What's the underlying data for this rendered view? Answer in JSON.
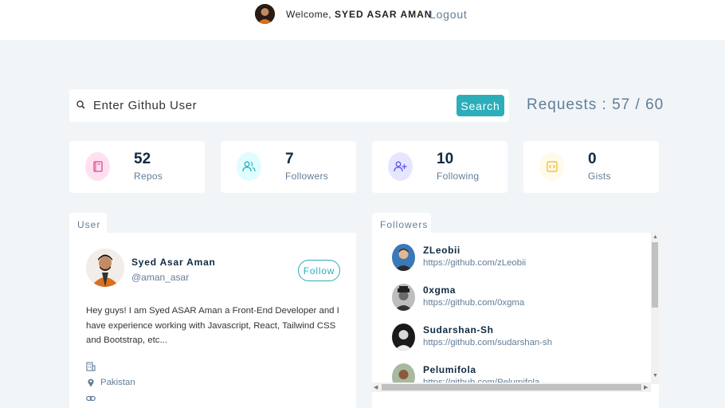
{
  "nav": {
    "welcome_prefix": "Welcome,",
    "username": "SYED ASAR AMAN",
    "logout": "Logout"
  },
  "search": {
    "placeholder": "Enter Github User",
    "button": "Search",
    "requests": "Requests : 57 / 60"
  },
  "stats": [
    {
      "value": "52",
      "label": "Repos",
      "icon": "book-icon",
      "color": "#da4a91",
      "bg": "#ffe0f0"
    },
    {
      "value": "7",
      "label": "Followers",
      "icon": "users-icon",
      "color": "#2caeba",
      "bg": "#e0fcff"
    },
    {
      "value": "10",
      "label": "Following",
      "icon": "user-plus-icon",
      "color": "#5d55fa",
      "bg": "#e6e6ff"
    },
    {
      "value": "0",
      "label": "Gists",
      "icon": "code-icon",
      "color": "#f0b429",
      "bg": "#fffbea"
    }
  ],
  "user": {
    "tab": "User",
    "name": "Syed Asar Aman",
    "handle": "@aman_asar",
    "follow": "Follow",
    "bio": "Hey guys! I am Syed ASAR Aman a Front-End Developer and I have experience working with Javascript, React, Tailwind CSS and Bootstrap, etc...",
    "location": "Pakistan"
  },
  "followers": {
    "tab": "Followers",
    "items": [
      {
        "name": "ZLeobii",
        "url": "https://github.com/zLeobii"
      },
      {
        "name": "0xgma",
        "url": "https://github.com/0xgma"
      },
      {
        "name": "Sudarshan-Sh",
        "url": "https://github.com/sudarshan-sh"
      },
      {
        "name": "Pelumifola",
        "url": "https://github.com/Pelumifola"
      }
    ]
  }
}
